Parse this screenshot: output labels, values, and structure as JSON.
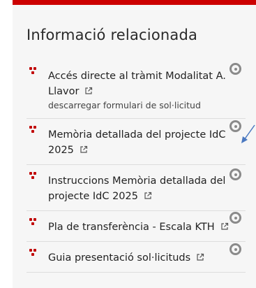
{
  "panel": {
    "accent_color": "#cc0000",
    "title": "Informació relacionada"
  },
  "links": [
    {
      "label": "Accés directe al tràmit Modalitat A. Llavor",
      "sublabel": "descarregar formulari de sol·licitud",
      "icon": "external-link-icon"
    },
    {
      "label": "Memòria detallada del projecte IdC 2025",
      "icon": "external-link-icon"
    },
    {
      "label": "Instruccions Memòria detallada del projecte IdC 2025",
      "icon": "external-link-icon"
    },
    {
      "label": "Pla de transferència - Escala KTH",
      "icon": "external-link-icon"
    },
    {
      "label": "Guia presentació sol·licituds",
      "icon": "external-link-icon"
    }
  ],
  "markers": {
    "icon": "target-circle-icon",
    "color": "#8a8a8a"
  },
  "annotation": {
    "icon": "arrow-pointer-icon",
    "color": "#4a78c0"
  }
}
